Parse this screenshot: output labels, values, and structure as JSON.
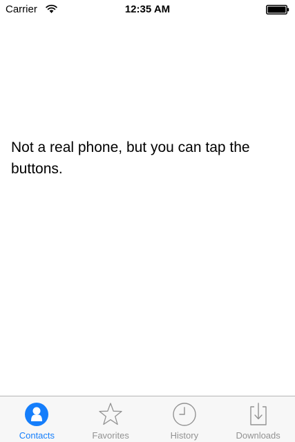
{
  "status_bar": {
    "carrier": "Carrier",
    "time": "12:35 AM",
    "wifi_icon": "wifi-icon",
    "battery_icon": "battery-icon"
  },
  "main": {
    "message": "Not a real phone, but you can tap the buttons."
  },
  "tab_bar": {
    "active_color": "#157efb",
    "inactive_color": "#929292",
    "tabs": [
      {
        "label": "Contacts",
        "icon": "contacts-icon",
        "active": true
      },
      {
        "label": "Favorites",
        "icon": "star-icon",
        "active": false
      },
      {
        "label": "History",
        "icon": "clock-icon",
        "active": false
      },
      {
        "label": "Downloads",
        "icon": "download-icon",
        "active": false
      }
    ]
  }
}
